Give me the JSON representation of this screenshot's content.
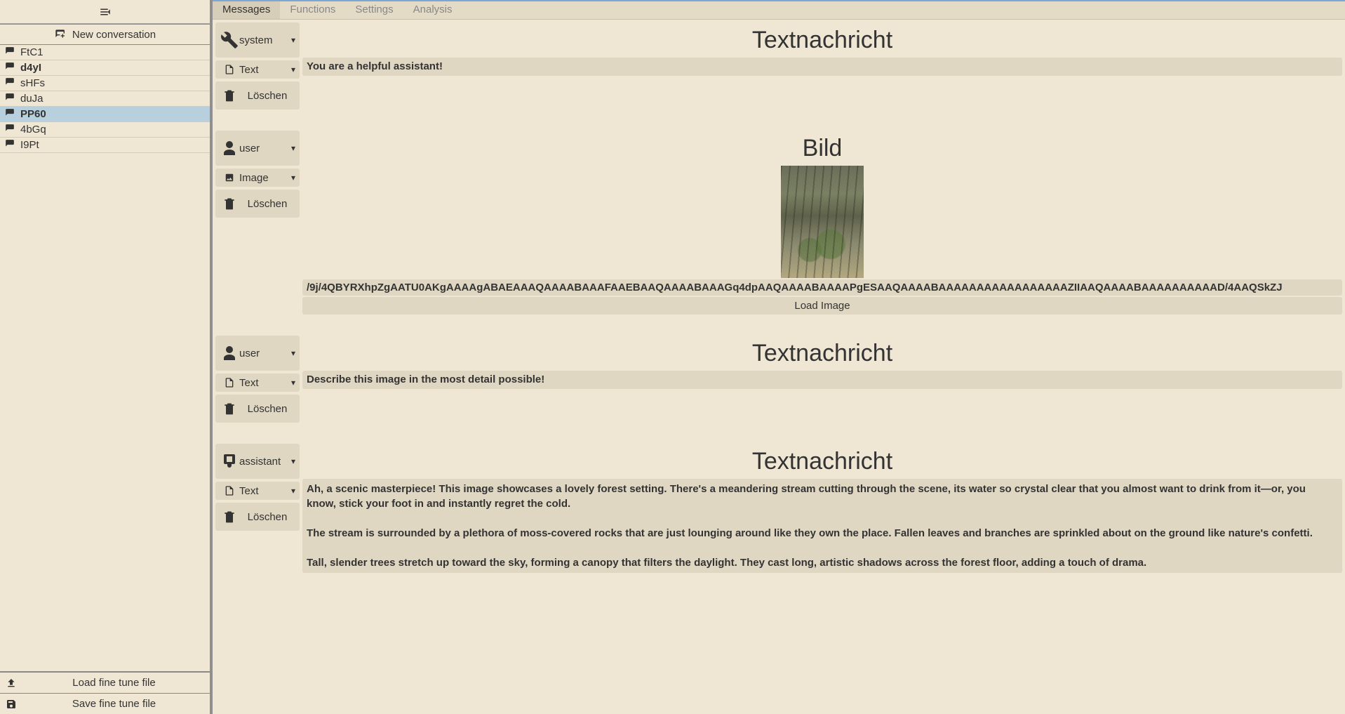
{
  "sidebar": {
    "new_conversation": "New conversation",
    "conversations": [
      {
        "label": "FtC1",
        "active": false,
        "cls": ""
      },
      {
        "label": "d4yI",
        "active": false,
        "cls": "d4yl"
      },
      {
        "label": "sHFs",
        "active": false,
        "cls": ""
      },
      {
        "label": "duJa",
        "active": false,
        "cls": ""
      },
      {
        "label": "PP60",
        "active": true,
        "cls": "active"
      },
      {
        "label": "4bGq",
        "active": false,
        "cls": ""
      },
      {
        "label": "I9Pt",
        "active": false,
        "cls": ""
      }
    ],
    "load_btn": "Load fine tune file",
    "save_btn": "Save fine tune file"
  },
  "tabs": [
    "Messages",
    "Functions",
    "Settings",
    "Analysis"
  ],
  "active_tab": 0,
  "labels": {
    "delete": "Löschen",
    "text_msg_title": "Textnachricht",
    "image_title": "Bild",
    "load_image": "Load Image"
  },
  "messages": [
    {
      "role": "system",
      "type": "Text",
      "title_key": "text_msg_title",
      "content": "You are a helpful assistant!"
    },
    {
      "role": "user",
      "type": "Image",
      "title_key": "image_title",
      "b64": "/9j/4QBYRXhpZgAATU0AKgAAAAgABAEAAAQAAAABAAAFAAEBAAQAAAABAAAGq4dpAAQAAAABAAAAPgESAAQAAAABAAAAAAAAAAAAAAAAAZIIAAQAAAABAAAAAAAAAAD/4AAQSkZJ",
      "content": ""
    },
    {
      "role": "user",
      "type": "Text",
      "title_key": "text_msg_title",
      "content": "Describe this image in the most detail possible!"
    },
    {
      "role": "assistant",
      "type": "Text",
      "title_key": "text_msg_title",
      "content": "Ah, a scenic masterpiece! This image showcases a lovely forest setting. There's a meandering stream cutting through the scene, its water so crystal clear that you almost want to drink from it—or, you know, stick your foot in and instantly regret the cold.\n\nThe stream is surrounded by a plethora of moss-covered rocks that are just lounging around like they own the place. Fallen leaves and branches are sprinkled about on the ground like nature's confetti.\n\nTall, slender trees stretch up toward the sky, forming a canopy that filters the daylight. They cast long, artistic shadows across the forest floor, adding a touch of drama."
    }
  ]
}
